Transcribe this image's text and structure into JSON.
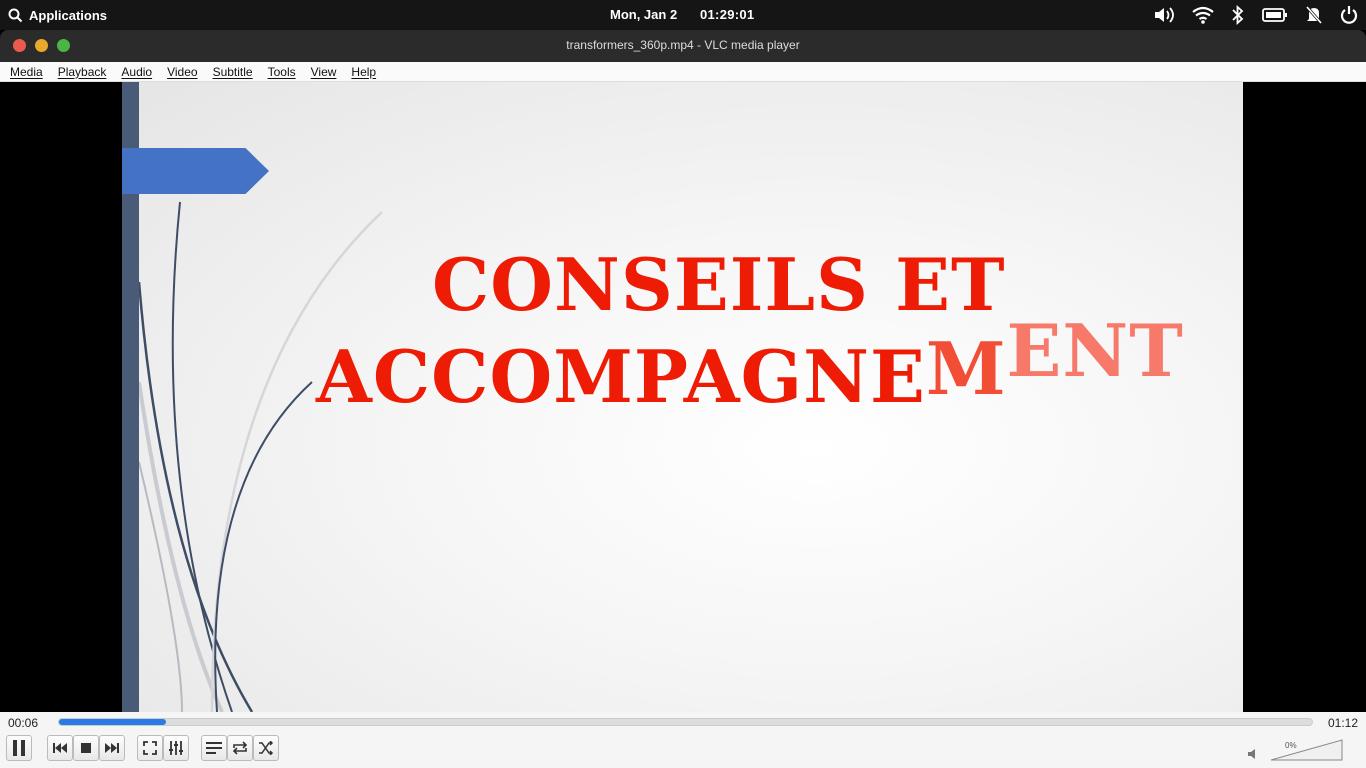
{
  "system_bar": {
    "applications_label": "Applications",
    "date": "Mon, Jan  2",
    "time": "01:29:01",
    "tray_icons": [
      "volume-icon",
      "wifi-icon",
      "bluetooth-icon",
      "battery-icon",
      "notifications-off-icon",
      "power-icon"
    ]
  },
  "window": {
    "title": "transformers_360p.mp4 - VLC media player"
  },
  "menu": {
    "items": [
      "Media",
      "Playback",
      "Audio",
      "Video",
      "Subtitle",
      "Tools",
      "View",
      "Help"
    ]
  },
  "slide": {
    "line1": "CONSEILS ET",
    "line2_main": "ACCOMPAGNE",
    "line2_mid": "M",
    "line2_fade": "ENT",
    "colors": {
      "text": "#ee1c05",
      "bar": "#495b77",
      "banner": "#4472c4"
    }
  },
  "player": {
    "current_time": "00:06",
    "total_time": "01:12",
    "progress": 0.085,
    "volume_label": "0%",
    "accent": "#2a7be4"
  }
}
